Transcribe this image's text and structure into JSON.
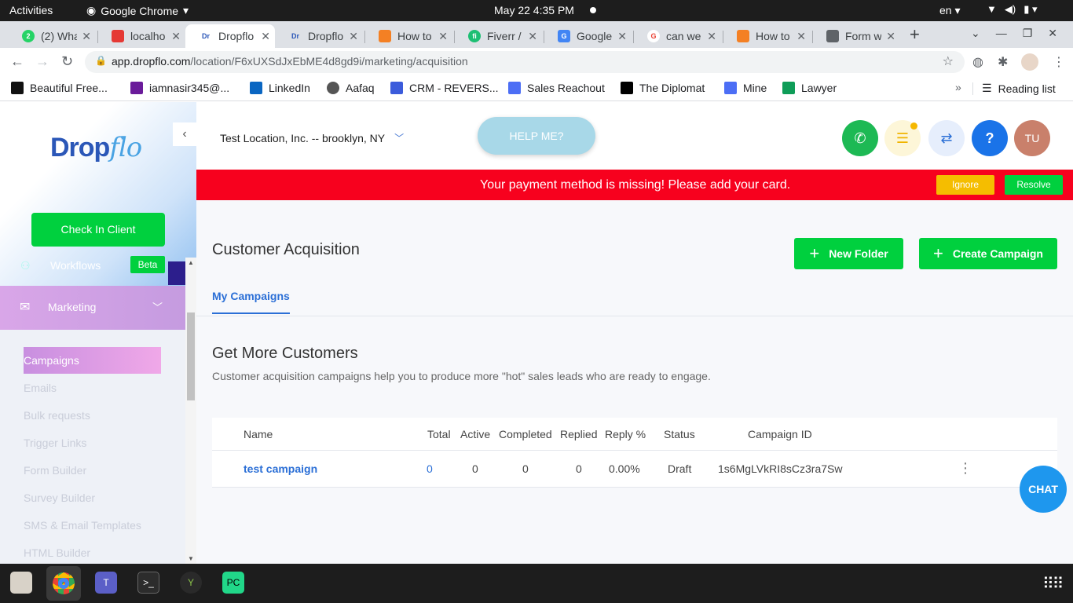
{
  "system": {
    "activities": "Activities",
    "app_name": "Google Chrome",
    "clock": "May 22  4:35 PM",
    "lang": "en"
  },
  "browser": {
    "tabs": [
      {
        "label": "(2) Wha",
        "color": "#25d366"
      },
      {
        "label": "localho",
        "color": "#e53935"
      },
      {
        "label": "Dropflo",
        "color": "#2b57b8",
        "active": true
      },
      {
        "label": "Dropflo",
        "color": "#2b57b8"
      },
      {
        "label": "How to",
        "color": "#f48024"
      },
      {
        "label": "Fiverr /",
        "color": "#1dbf73"
      },
      {
        "label": "Google",
        "color": "#4285f4"
      },
      {
        "label": "can we",
        "color": "#ea4335"
      },
      {
        "label": "How to",
        "color": "#f48024"
      },
      {
        "label": "Form w",
        "color": "#5f6368"
      }
    ],
    "url_host": "app.dropflo.com",
    "url_path": "/location/F6xUXSdJxEbME4d8gd9i/marketing/acquisition",
    "bookmarks": [
      {
        "label": "Beautiful Free...",
        "color": "#111111"
      },
      {
        "label": "iamnasir345@...",
        "color": "#6a1b9a"
      },
      {
        "label": "LinkedIn",
        "color": "#0a66c2"
      },
      {
        "label": "Aafaq",
        "color": "#555555"
      },
      {
        "label": "CRM - REVERS...",
        "color": "#3b5bdb"
      },
      {
        "label": "Sales Reachout",
        "color": "#4c6ef5"
      },
      {
        "label": "The Diplomat",
        "color": "#000000"
      },
      {
        "label": "Mine",
        "color": "#4c6ef5"
      },
      {
        "label": "Lawyer",
        "color": "#0f9d58"
      }
    ],
    "reading_list": "Reading list"
  },
  "sidebar": {
    "logo_drop": "Drop",
    "logo_flo": "flo",
    "check_in": "Check In Client",
    "workflows": "Workflows",
    "beta": "Beta",
    "marketing": "Marketing",
    "submenu": [
      "Campaigns",
      "Emails",
      "Bulk requests",
      "Trigger Links",
      "Form Builder",
      "Survey Builder",
      "SMS & Email Templates",
      "HTML Builder"
    ]
  },
  "header": {
    "location": "Test Location, Inc. -- brooklyn, NY",
    "help": "HELP ME?",
    "avatar": "TU"
  },
  "alert": {
    "message": "Your payment method is missing! Please add your card.",
    "ignore": "Ignore",
    "resolve": "Resolve"
  },
  "main": {
    "title": "Customer Acquisition",
    "new_folder": "New Folder",
    "create_campaign": "Create Campaign",
    "tab": "My Campaigns",
    "section_title": "Get More Customers",
    "section_desc": "Customer acquisition campaigns help you to produce more \"hot\" sales leads who are ready to engage.",
    "table": {
      "headers": [
        "Name",
        "Total",
        "Active",
        "Completed",
        "Replied",
        "Reply %",
        "Status",
        "Campaign ID"
      ],
      "rows": [
        {
          "name": "test campaign",
          "total": "0",
          "active": "0",
          "completed": "0",
          "replied": "0",
          "reply_pct": "0.00%",
          "status": "Draft",
          "id": "1s6MgLVkRI8sCz3ra7Sw"
        }
      ]
    },
    "chat": "CHAT"
  }
}
